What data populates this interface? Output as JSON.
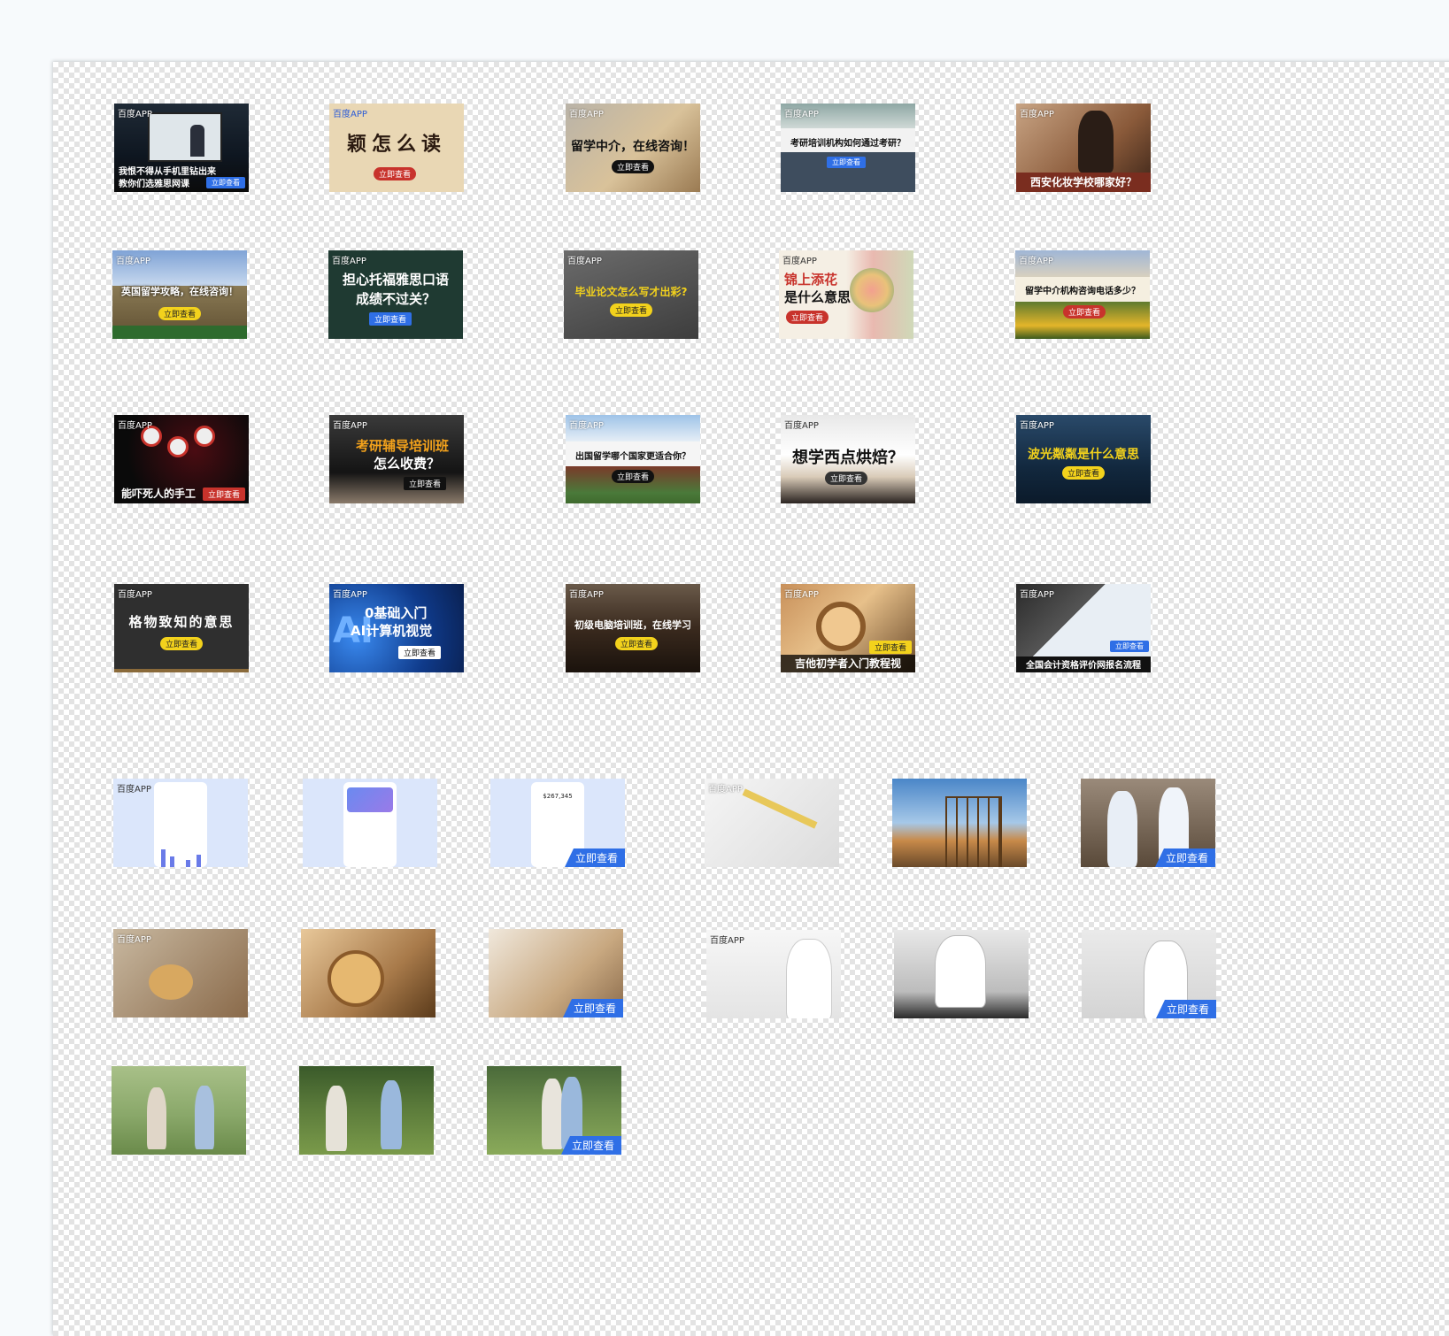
{
  "brand_label": "百度APP",
  "thumbnails": [
    {
      "title_l1": "我恨不得从手机里钻出来",
      "title_l2": "教你们选雅思网课",
      "cta": "立即查看"
    },
    {
      "title_l1": "颖怎么读",
      "cta": "立即查看"
    },
    {
      "title_l1": "留学中介，在线咨询！",
      "cta": "立即查看"
    },
    {
      "title_l1": "考研培训机构如何通过考研？",
      "cta": "立即查看"
    },
    {
      "title_l1": "西安化妆学校哪家好？"
    },
    {
      "title_l1": "英国留学攻略，在线咨询！",
      "cta": "立即查看"
    },
    {
      "title_l1": "担心托福雅思口语",
      "title_l2": "成绩不过关？",
      "cta": "立即查看"
    },
    {
      "title_l1": "毕业论文怎么写才出彩?",
      "cta": "立即查看"
    },
    {
      "title_l1": "锦上添花",
      "title_l2": "是什么意思",
      "cta": "立即查看"
    },
    {
      "title_l1": "留学中介机构咨询电话多少？",
      "cta": "立即查看"
    },
    {
      "title_l1": "能吓死人的手工",
      "cta": "立即查看"
    },
    {
      "title_l1": "考研辅导培训班",
      "title_l2": "怎么收费？",
      "cta": "立即查看"
    },
    {
      "title_l1": "出国留学哪个国家更适合你？",
      "cta": "立即查看"
    },
    {
      "title_l1": "想学西点烘焙？",
      "cta": "立即查看"
    },
    {
      "title_l1": "波光粼粼是什么意思",
      "cta": "立即查看"
    },
    {
      "title_l1": "格物致知的意思",
      "cta": "立即查看"
    },
    {
      "title_l1": "0基础入门",
      "title_l2": "AI计算机视觉",
      "cta": "立即查看"
    },
    {
      "title_l1": "初级电脑培训班，在线学习",
      "cta": "立即查看"
    },
    {
      "title_l1": "吉他初学者入门教程视",
      "cta": "立即查看"
    },
    {
      "title_l1": "全国会计资格评价网报名流程",
      "cta": "立即查看"
    }
  ],
  "bottom_cta": "立即查看",
  "phone_amount": "$267,345"
}
